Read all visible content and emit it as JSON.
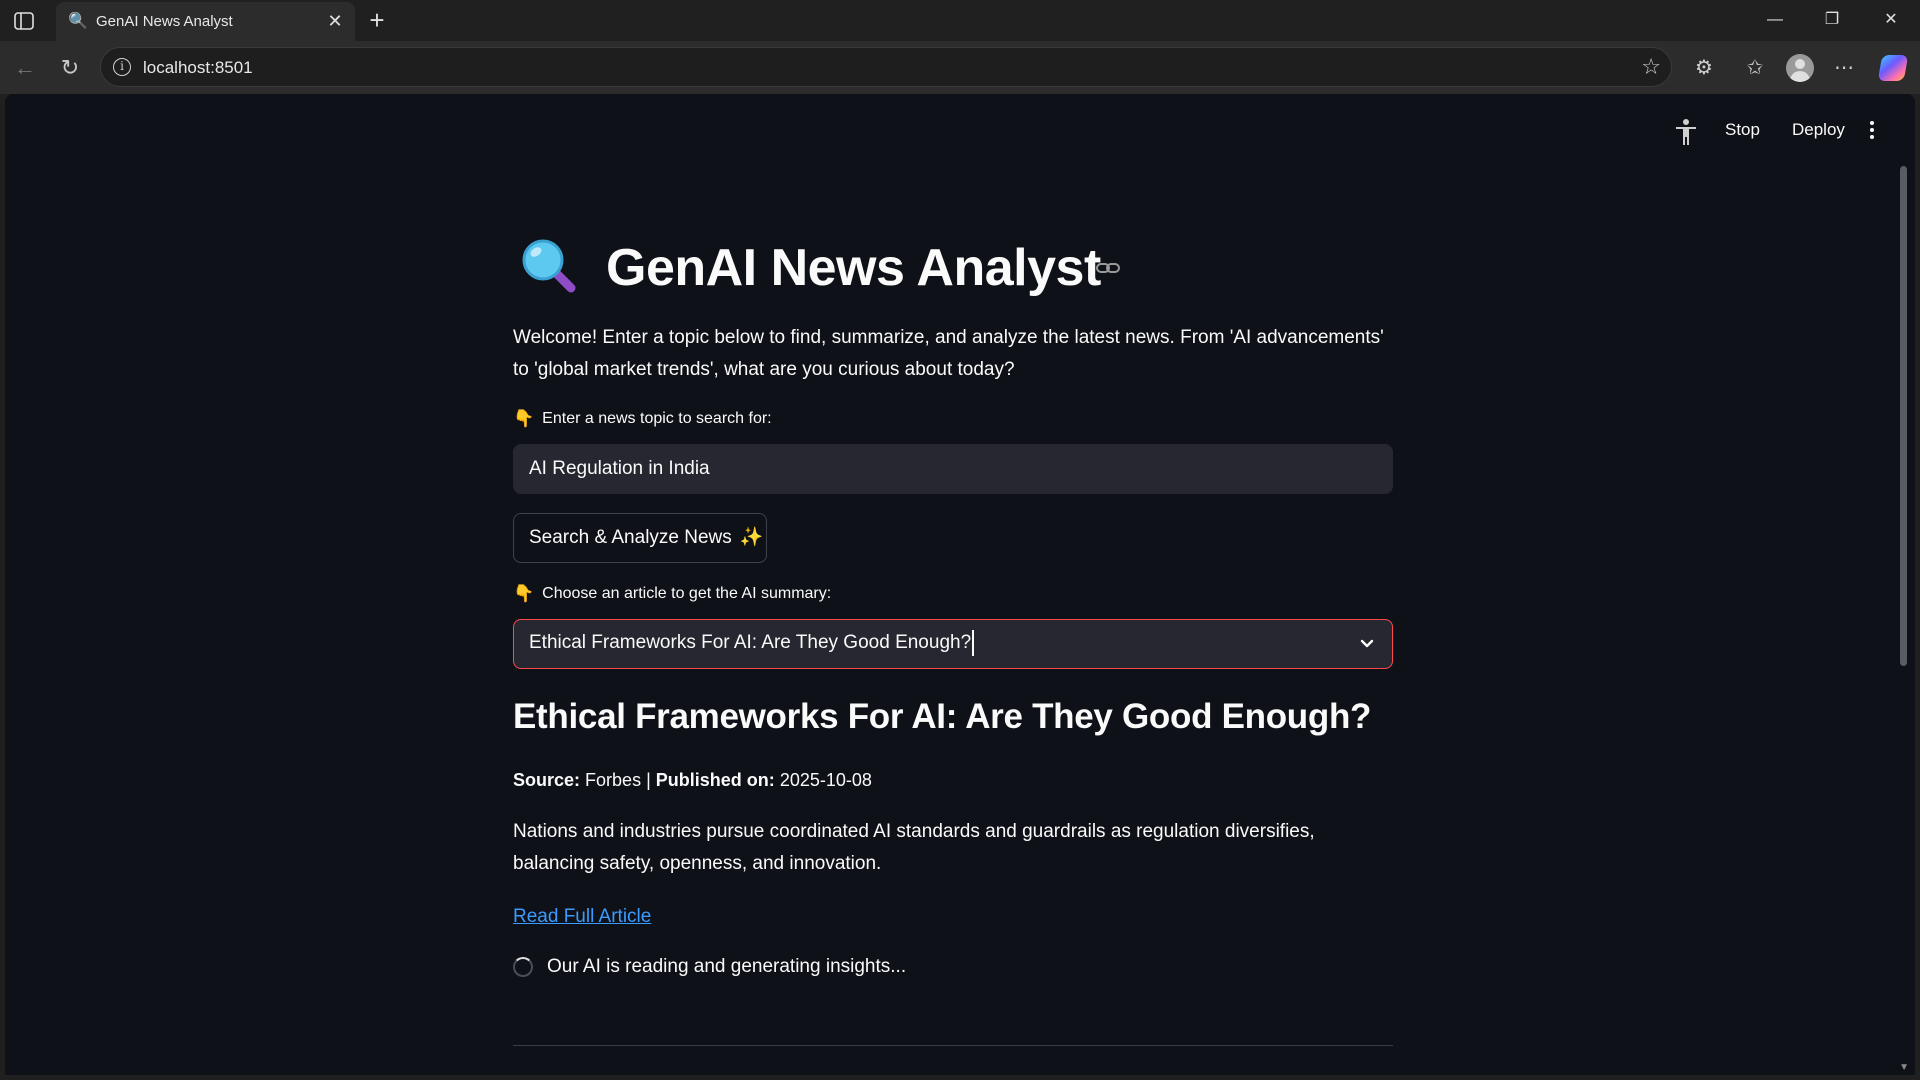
{
  "browser": {
    "tab_title": "GenAI News Analyst",
    "url": "localhost:8501"
  },
  "app_header": {
    "stop_label": "Stop",
    "deploy_label": "Deploy"
  },
  "page": {
    "title": "GenAI News Analyst",
    "intro": "Welcome! Enter a topic below to find, summarize, and analyze the latest news. From 'AI advancements' to 'global market trends', what are you curious about today?",
    "topic_label": "Enter a news topic to search for:",
    "topic_value": "AI Regulation in India",
    "search_button_label": "Search & Analyze News",
    "article_select_label": "Choose an article to get the AI summary:",
    "article_select_value": "Ethical Frameworks For AI: Are They Good Enough?",
    "label_emoji": "👇",
    "button_emoji": "✨"
  },
  "article": {
    "title": "Ethical Frameworks For AI: Are They Good Enough?",
    "source_label": "Source:",
    "source_value": "Forbes",
    "separator": "|",
    "published_label": "Published on:",
    "published_value": "2025-10-08",
    "description": "Nations and industries pursue coordinated AI standards and guardrails as regulation diversifies, balancing safety, openness, and innovation.",
    "read_link_label": "Read Full Article",
    "status_text": "Our AI is reading and generating insights..."
  },
  "colors": {
    "background": "#0e1117",
    "input_bg": "#262730",
    "accent_red": "#ff4b4b",
    "link_blue": "#3b9bff"
  }
}
